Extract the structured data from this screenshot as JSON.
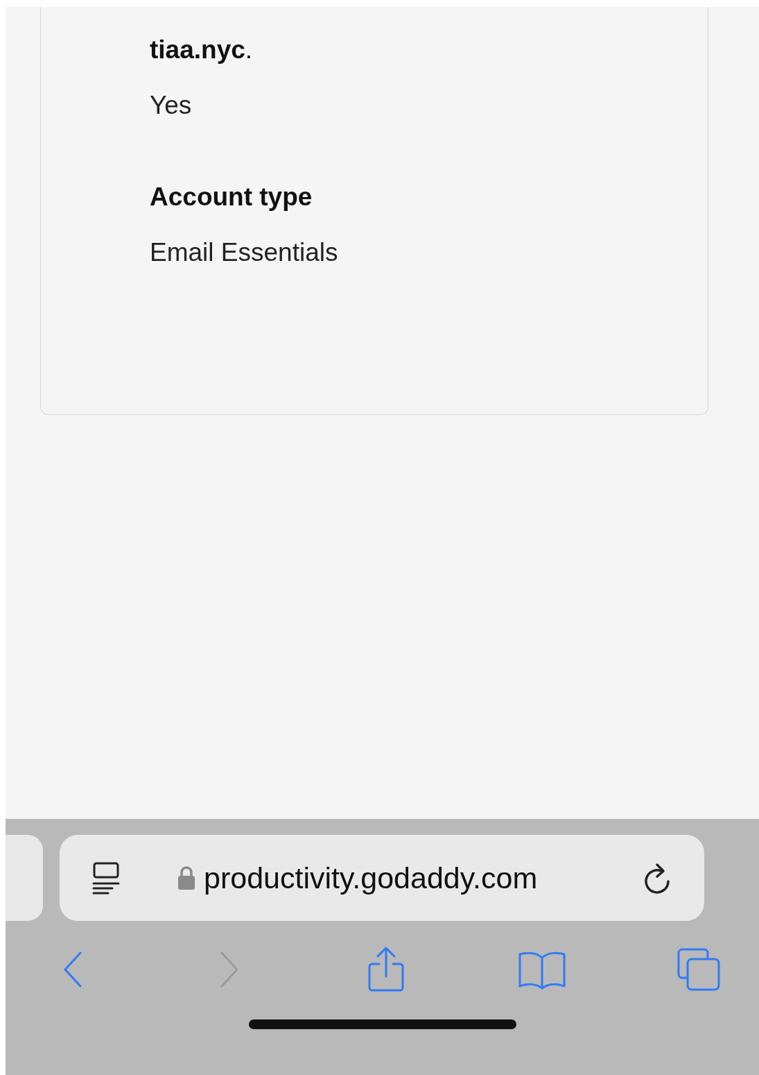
{
  "card": {
    "fields": [
      {
        "kind": "paragraph",
        "text": "**tiaa.nyc**."
      },
      {
        "kind": "value",
        "text": "Yes"
      },
      {
        "kind": "label",
        "text": "Account type"
      },
      {
        "kind": "value",
        "text": "Email Essentials"
      }
    ]
  },
  "browser_bar": {
    "url": "productivity.godaddy.com",
    "nav": [
      {
        "kind": "back",
        "disabled": false
      },
      {
        "kind": "forward",
        "disabled": true
      },
      {
        "kind": "share",
        "disabled": false
      },
      {
        "kind": "bookmarks",
        "disabled": false
      },
      {
        "kind": "tabs",
        "disabled": false
      }
    ]
  }
}
